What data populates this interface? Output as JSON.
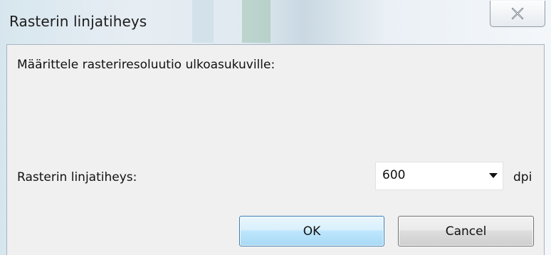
{
  "window": {
    "title": "Rasterin linjatiheys"
  },
  "dialog": {
    "description": "Määrittele rasteriresoluutio ulkoasukuville:",
    "field_label": "Rasterin linjatiheys:",
    "resolution_value": "600",
    "unit": "dpi"
  },
  "buttons": {
    "ok_label": "OK",
    "cancel_label": "Cancel"
  },
  "icons": {
    "close": "close-icon",
    "dropdown": "dropdown-arrow-icon"
  },
  "colors": {
    "ok_border": "#3c7fb1",
    "client_background": "#f0f0f0"
  }
}
